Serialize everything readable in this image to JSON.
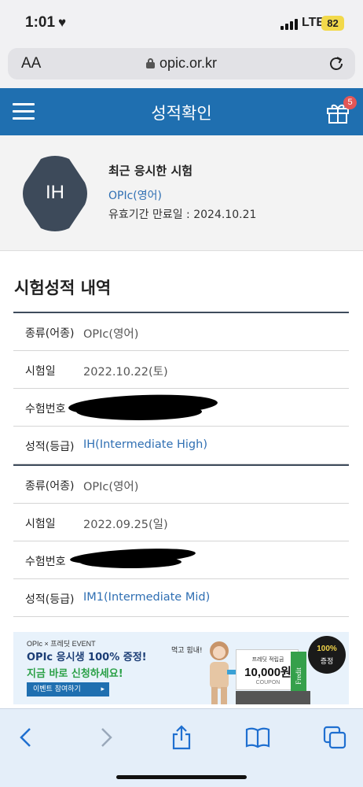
{
  "status_bar": {
    "time": "1:01",
    "heart": "♥",
    "network": "LTE",
    "battery": "82"
  },
  "browser": {
    "text_size_label": "AA",
    "url": "opic.or.kr"
  },
  "header": {
    "title": "성적확인",
    "gift_badge_count": "5"
  },
  "profile": {
    "grade_badge": "IH",
    "recent_label": "최근 응시한 시험",
    "exam_name": "OPIc(영어)",
    "expiry": "유효기간 만료일 : 2024.10.21"
  },
  "section": {
    "title": "시험성적 내역"
  },
  "records": [
    {
      "type_label": "종류(어종)",
      "type_value": "OPIc(영어)",
      "date_label": "시험일",
      "date_value": "2022.10.22(토)",
      "id_label": "수험번호",
      "grade_label": "성적(등급)",
      "grade_value": "IH(Intermediate High)"
    },
    {
      "type_label": "종류(어종)",
      "type_value": "OPIc(영어)",
      "date_label": "시험일",
      "date_value": "2022.09.25(일)",
      "id_label": "수험번호",
      "grade_label": "성적(등급)",
      "grade_value": "IM1(Intermediate Mid)"
    }
  ],
  "banner": {
    "subtitle": "OPIc × 프레딧 EVENT",
    "line1": "OPIc 응시생 100% 증정!",
    "line2": "지금 바로 신청하세요!",
    "button": "이벤트 참여하기",
    "bubble": "먹고 힘내!",
    "coupon_title": "프레딧 적립금",
    "coupon_amount": "10,000원",
    "coupon_label": "COUPON",
    "brand": "Fredit",
    "badge_percent": "100%",
    "badge_text": "증정"
  },
  "colors": {
    "header_blue": "#1f6fb0",
    "link_blue": "#2f6fb3",
    "hex_badge": "#3d4a5a"
  }
}
